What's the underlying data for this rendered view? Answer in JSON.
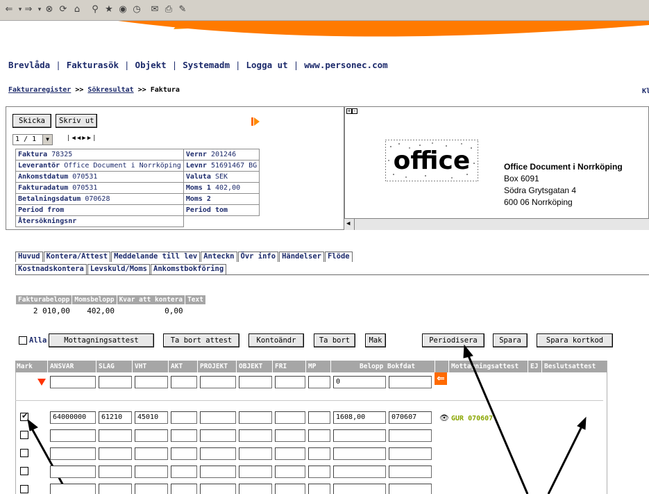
{
  "nav": {
    "items": [
      "Brevlåda",
      "Fakturasök",
      "Objekt",
      "Systemadm",
      "Logga ut",
      "www.personec.com"
    ]
  },
  "breadcrumb": {
    "link1": "Fakturaregister",
    "sep": ">>",
    "link2": "Sökresultat",
    "current": "Faktura",
    "right": "Kl"
  },
  "invoice": {
    "send_label": "Skicka",
    "print_label": "Skriv ut",
    "page_select": "1 / 1",
    "rows": [
      [
        {
          "label": "Faktura",
          "value": "78325"
        },
        {
          "label": "Vernr",
          "value": "201246"
        }
      ],
      [
        {
          "label": "Leverantör",
          "value": "Office Document i Norrköping"
        },
        {
          "label": "Levnr",
          "value": "51691467 BG"
        }
      ],
      [
        {
          "label": "Ankomstdatum",
          "value": "070531"
        },
        {
          "label": "Valuta",
          "value": "SEK"
        }
      ],
      [
        {
          "label": "Fakturadatum",
          "value": "070531"
        },
        {
          "label": "Moms 1",
          "value": "402,00"
        }
      ],
      [
        {
          "label": "Betalningsdatum",
          "value": "070628"
        },
        {
          "label": "Moms 2",
          "value": ""
        }
      ],
      [
        {
          "label": "Period from",
          "value": ""
        },
        {
          "label": "Period tom",
          "value": ""
        }
      ],
      [
        {
          "label": "Återsökningsnr",
          "value": ""
        },
        null
      ]
    ]
  },
  "document": {
    "logo_text": "office",
    "vendor_name": "Office Document i Norrköping",
    "vendor_box": "Box 6091",
    "vendor_street": "Södra Grytsgatan 4",
    "vendor_city": "600 06 Norrköping"
  },
  "tabs": {
    "row1": [
      "Huvud",
      "Kontera/Attest",
      "Meddelande till lev",
      "Anteckn",
      "Övr info",
      "Händelser",
      "Flöde"
    ],
    "row2": [
      "Kostnadskontera",
      "Levskuld/Moms",
      "Ankomstbokföring"
    ]
  },
  "summary": {
    "headers": [
      "Fakturabelopp",
      "Momsbelopp",
      "Kvar att kontera",
      "Text"
    ],
    "values": [
      "2 010,00",
      "402,00",
      "0,00",
      ""
    ]
  },
  "actions": {
    "all_label": "Alla",
    "buttons": [
      "Mottagningsattest",
      "Ta bort attest",
      "Kontoändr",
      "Ta bort",
      "Mak",
      "Periodisera",
      "Spara",
      "Spara kortkod"
    ]
  },
  "grid": {
    "headers": [
      "Mark",
      "ANSVAR",
      "SLAG",
      "VHT",
      "AKT",
      "PROJEKT",
      "OBJEKT",
      "FRI",
      "MP",
      "Belopp",
      "Bokfdat",
      "Mottagningsattest",
      "EJ",
      "Beslutsattest"
    ],
    "filter_belopp": "0",
    "row1": {
      "ansvar": "64000000",
      "slag": "61210",
      "vht": "45010",
      "belopp": "1608,00",
      "bokfdat": "070607",
      "attest": "GUR 070607"
    },
    "colors": {
      "header_bg": "#a6a6a6",
      "link": "#1c2a6b",
      "accent": "#ff6a00",
      "attest": "#8aa600"
    }
  }
}
